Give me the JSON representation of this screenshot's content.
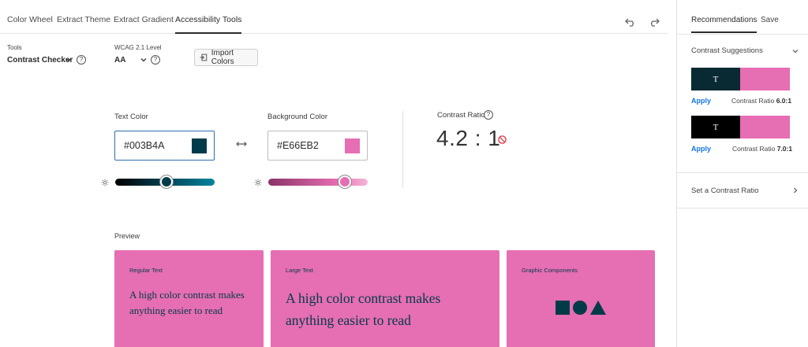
{
  "nav": {
    "tabs": [
      {
        "label": "Color Wheel"
      },
      {
        "label": "Extract Theme"
      },
      {
        "label": "Extract Gradient"
      },
      {
        "label": "Accessibility Tools"
      }
    ],
    "active_tab": "Accessibility Tools"
  },
  "tools": {
    "label": "Tools",
    "value": "Contrast Checker",
    "help_icon": "?"
  },
  "wcag": {
    "label": "WCAG 2.1 Level",
    "value": "AA",
    "help_icon": "?"
  },
  "import_button": {
    "label": "Import Colors",
    "icon": "import-icon"
  },
  "text_color": {
    "label": "Text Color",
    "value": "#003B4A",
    "swatch": "#003B4A",
    "slider_level": 0.43
  },
  "background_color": {
    "label": "Background Color",
    "value": "#E66EB2",
    "swatch": "#E66EB2",
    "slider_level": 0.78
  },
  "contrast": {
    "label": "Contrast Ratio",
    "value": "4.2 : 1",
    "status_icon": "fail-icon",
    "help_icon": "?"
  },
  "preview": {
    "label": "Preview",
    "cards": [
      {
        "title": "Regular Text",
        "text": "A high color contrast makes anything easier to read"
      },
      {
        "title": "Large Text",
        "text": "A high color contrast makes anything easier to read"
      },
      {
        "title": "Graphic Components",
        "shapes": [
          "square",
          "circle",
          "triangle"
        ]
      }
    ]
  },
  "right_panel": {
    "tabs": [
      {
        "label": "Recommendations"
      },
      {
        "label": "Save"
      }
    ],
    "active_tab": "Recommendations",
    "suggestions_title": "Contrast Suggestions",
    "suggestions": [
      {
        "glyph": "T",
        "text_color": "#0A2A33",
        "bg_color": "#E66EB2",
        "apply_label": "Apply",
        "ratio_label": "Contrast Ratio",
        "ratio_value": "6.0:1"
      },
      {
        "glyph": "T",
        "text_color": "#000000",
        "bg_color": "#E66EB2",
        "apply_label": "Apply",
        "ratio_label": "Contrast Ratio",
        "ratio_value": "7.0:1"
      }
    ],
    "set_ratio_label": "Set a Contrast Ratio"
  },
  "colors": {
    "accent_link": "#1473e6",
    "fail": "#d7373f"
  }
}
